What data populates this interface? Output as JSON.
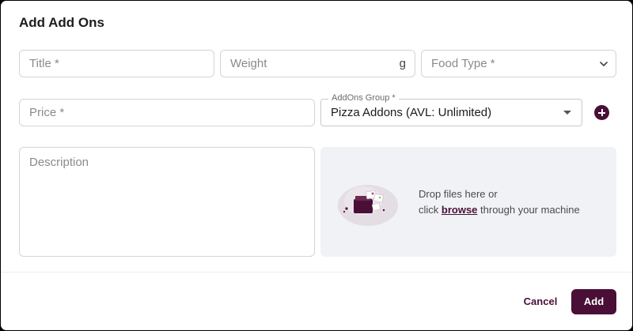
{
  "dialog": {
    "title": "Add Add Ons"
  },
  "form": {
    "title_placeholder": "Title *",
    "weight_placeholder": "Weight",
    "weight_unit": "g",
    "food_type_placeholder": "Food Type *",
    "price_placeholder": "Price *",
    "addons_group_label": "AddOns Group *",
    "addons_group_value": "Pizza Addons (AVL: Unlimited)",
    "description_placeholder": "Description"
  },
  "dropzone": {
    "line1": "Drop files here or",
    "click_text": "click ",
    "browse_link": "browse",
    "line2_suffix": " through your machine",
    "illustration_icon": "file-upload-illustration"
  },
  "actions": {
    "cancel_label": "Cancel",
    "add_label": "Add"
  },
  "colors": {
    "primary": "#4a0f36",
    "dropzone_bg": "#f0f2f5"
  }
}
